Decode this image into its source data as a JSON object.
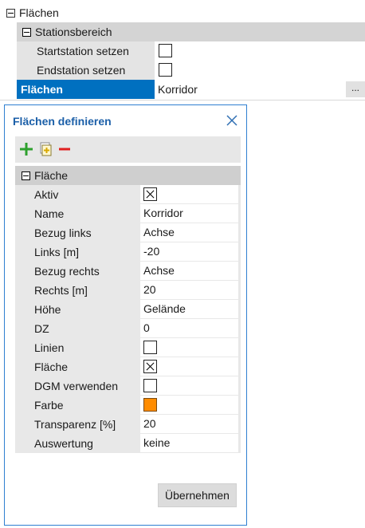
{
  "property_grid": {
    "category_label": "Flächen",
    "stationsbereich": {
      "label": "Stationsbereich",
      "start_label": "Startstation setzen",
      "start_checked": false,
      "end_label": "Endstation setzen",
      "end_checked": false
    },
    "selected_row": {
      "label": "Flächen",
      "value": "Korridor",
      "more_button": "..."
    }
  },
  "dialog": {
    "title": "Flächen definieren",
    "toolbar": {
      "add_icon": "plus-icon",
      "copy_icon": "copy-icon",
      "remove_icon": "minus-icon"
    },
    "group_label": "Fläche",
    "fields": [
      {
        "label": "Aktiv",
        "type": "checkbox",
        "checked": true
      },
      {
        "label": "Name",
        "type": "text",
        "value": "Korridor"
      },
      {
        "label": "Bezug links",
        "type": "text",
        "value": "Achse"
      },
      {
        "label": "Links [m]",
        "type": "text",
        "value": "-20"
      },
      {
        "label": "Bezug rechts",
        "type": "text",
        "value": "Achse"
      },
      {
        "label": "Rechts [m]",
        "type": "text",
        "value": "20"
      },
      {
        "label": "Höhe",
        "type": "text",
        "value": "Gelände"
      },
      {
        "label": "DZ",
        "type": "text",
        "value": "0"
      },
      {
        "label": "Linien",
        "type": "checkbox",
        "checked": false
      },
      {
        "label": "Fläche",
        "type": "checkbox",
        "checked": true
      },
      {
        "label": "DGM verwenden",
        "type": "checkbox",
        "checked": false
      },
      {
        "label": "Farbe",
        "type": "color",
        "color": "#ff8c00"
      },
      {
        "label": "Transparenz [%]",
        "type": "text",
        "value": "20"
      },
      {
        "label": "Auswertung",
        "type": "text",
        "value": "keine"
      }
    ],
    "apply_label": "Übernehmen"
  },
  "colors": {
    "selected_row_bg": "#0070c0",
    "dialog_border": "#2f7fd1",
    "title_color": "#1b5fa8",
    "farbe_swatch": "#ff8c00"
  }
}
